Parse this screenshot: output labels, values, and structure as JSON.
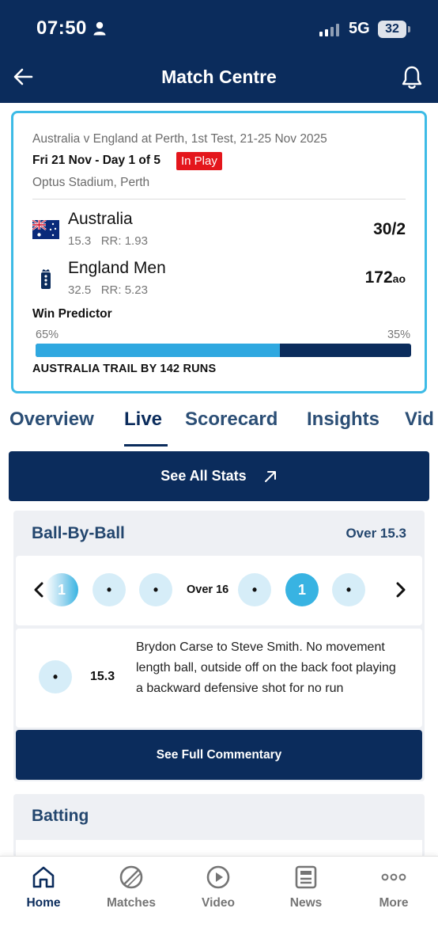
{
  "status_bar": {
    "time": "07:50",
    "network": "5G",
    "battery": "32"
  },
  "header": {
    "title": "Match Centre"
  },
  "match": {
    "description": "Australia v England at Perth, 1st Test, 21-25 Nov 2025",
    "day": "Fri 21 Nov - Day 1 of 5",
    "status_badge": "In Play",
    "venue": "Optus Stadium, Perth",
    "teams": [
      {
        "name": "Australia",
        "overs": "15.3",
        "run_rate": "RR: 1.93",
        "score": "30/2",
        "score_suffix": ""
      },
      {
        "name": "England Men",
        "overs": "32.5",
        "run_rate": "RR: 5.23",
        "score": "172",
        "score_suffix": "ao"
      }
    ],
    "win_predictor": {
      "label": "Win Predictor",
      "left_pct": "65%",
      "right_pct": "35%",
      "left_value": 65,
      "left_color": "#2fa8e0",
      "right_color": "#0b2c5c"
    },
    "trail_text": "AUSTRALIA TRAIL BY 142 RUNS"
  },
  "tabs": [
    {
      "label": "Overview",
      "active": false
    },
    {
      "label": "Live",
      "active": true
    },
    {
      "label": "Scorecard",
      "active": false
    },
    {
      "label": "Insights",
      "active": false
    },
    {
      "label": "Vid",
      "active": false
    }
  ],
  "see_all_stats": {
    "label": "See All Stats"
  },
  "ball_by_ball": {
    "title": "Ball-By-Ball",
    "current_over": "Over 15.3",
    "over_label": "Over 16",
    "balls": [
      "1",
      "•",
      "•",
      "•",
      "1",
      "•"
    ],
    "commentary": {
      "ball": "•",
      "over": "15.3",
      "text": "Brydon Carse to Steve Smith. No movement length ball, outside off on the back foot playing a backward defensive shot for no run"
    },
    "full_commentary_label": "See Full Commentary"
  },
  "batting": {
    "title": "Batting"
  },
  "bottom_nav": [
    {
      "label": "Home",
      "icon": "home-icon",
      "active": true
    },
    {
      "label": "Matches",
      "icon": "cricket-ball-icon",
      "active": false
    },
    {
      "label": "Video",
      "icon": "play-icon",
      "active": false
    },
    {
      "label": "News",
      "icon": "news-icon",
      "active": false
    },
    {
      "label": "More",
      "icon": "more-dots-icon",
      "active": false
    }
  ],
  "colors": {
    "brand_navy": "#0b2c5c",
    "accent_cyan": "#3dbbe6",
    "live_red": "#e4161c"
  }
}
